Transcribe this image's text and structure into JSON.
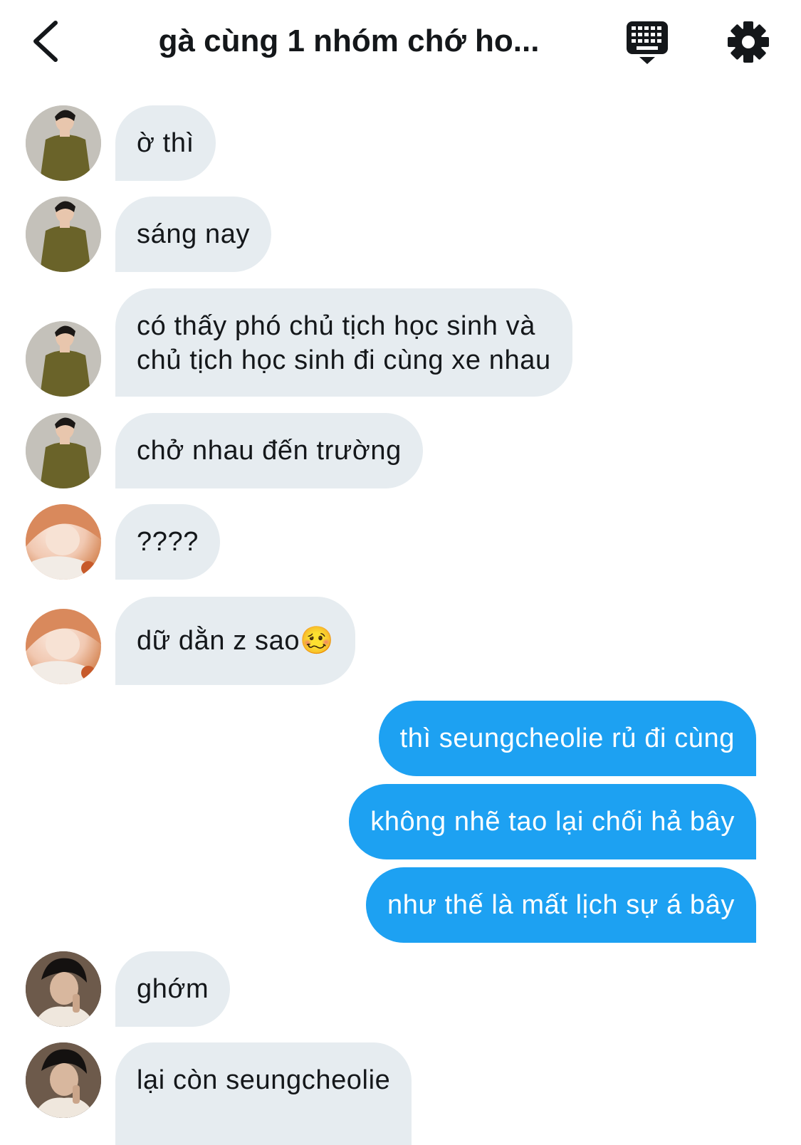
{
  "header": {
    "back_icon": "chevron-left-icon",
    "title": "gà cùng 1 nhóm chớ ho...",
    "keyboard_icon": "keyboard-icon",
    "settings_icon": "gear-icon"
  },
  "colors": {
    "incoming_bubble": "#e6ecf0",
    "outgoing_bubble": "#1da1f2",
    "text": "#14171a"
  },
  "messages": [
    {
      "direction": "incoming",
      "avatar": "avatar-olive-shirt",
      "text": "ờ thì"
    },
    {
      "direction": "incoming",
      "avatar": "avatar-olive-shirt",
      "text": "sáng nay"
    },
    {
      "direction": "incoming",
      "avatar": "avatar-olive-shirt",
      "lines": [
        "có thấy phó chủ tịch học sinh và",
        "chủ tịch học sinh đi cùng xe nhau"
      ]
    },
    {
      "direction": "incoming",
      "avatar": "avatar-olive-shirt",
      "text": "chở nhau đến trường"
    },
    {
      "direction": "incoming",
      "avatar": "avatar-orange-hair",
      "text": "????"
    },
    {
      "direction": "incoming",
      "avatar": "avatar-orange-hair",
      "text": "dữ dằn z sao🥴"
    },
    {
      "direction": "outgoing",
      "text": "thì seungcheolie rủ đi cùng"
    },
    {
      "direction": "outgoing",
      "text": "không nhẽ tao lại chối hả bây"
    },
    {
      "direction": "outgoing",
      "text": "như thế là mất lịch sự á bây"
    },
    {
      "direction": "incoming",
      "avatar": "avatar-dark-hair",
      "text": "ghớm"
    },
    {
      "direction": "incoming",
      "avatar": "avatar-dark-hair",
      "text": "lại còn seungcheolie"
    }
  ]
}
